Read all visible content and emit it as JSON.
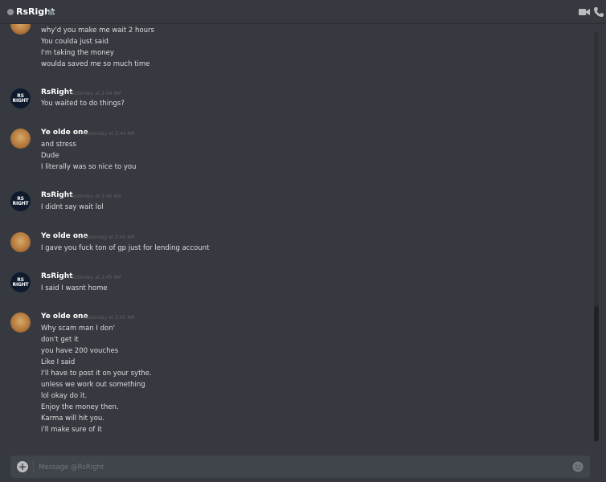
{
  "header": {
    "title": "RsRight",
    "icons": [
      "status-dot",
      "video-camera-icon",
      "phone-icon"
    ]
  },
  "avatars": {
    "rsright_text_line1": "RS",
    "rsright_text_line2": "RIGHT"
  },
  "messages": [
    {
      "author": "",
      "timestamp": "",
      "lines": [
        "why'd you make me wait 2 hours",
        "You coulda just said",
        "I'm taking the money",
        "woulda saved me so much time"
      ]
    },
    {
      "author": "RsRight",
      "timestamp": "Yesterday at 2:44 AM",
      "lines": [
        "You waited to do things?"
      ]
    },
    {
      "author": "Ye olde one",
      "timestamp": "Yesterday at 2:44 AM",
      "lines": [
        "and stress",
        "Dude",
        "I literally was so nice to you"
      ]
    },
    {
      "author": "RsRight",
      "timestamp": "Yesterday at 2:45 AM",
      "lines": [
        "I didnt say wait lol"
      ]
    },
    {
      "author": "Ye olde one",
      "timestamp": "Yesterday at 2:45 AM",
      "lines": [
        "I gave you fuck ton of gp just for lending account"
      ]
    },
    {
      "author": "RsRight",
      "timestamp": "Yesterday at 2:45 AM",
      "lines": [
        "I said I wasnt home"
      ]
    },
    {
      "author": "Ye olde one",
      "timestamp": "Yesterday at 2:45 AM",
      "lines": [
        "Why scam man I don'",
        "don't get it",
        "you have 200 vouches",
        "Like I said",
        "I'll have to post it on your sythe.",
        "unless we work out something",
        "lol okay do it.",
        "Enjoy the money then.",
        "Karma will hit you.",
        "i'll make sure of it"
      ]
    }
  ],
  "composer": {
    "placeholder": "Message @RsRight"
  }
}
